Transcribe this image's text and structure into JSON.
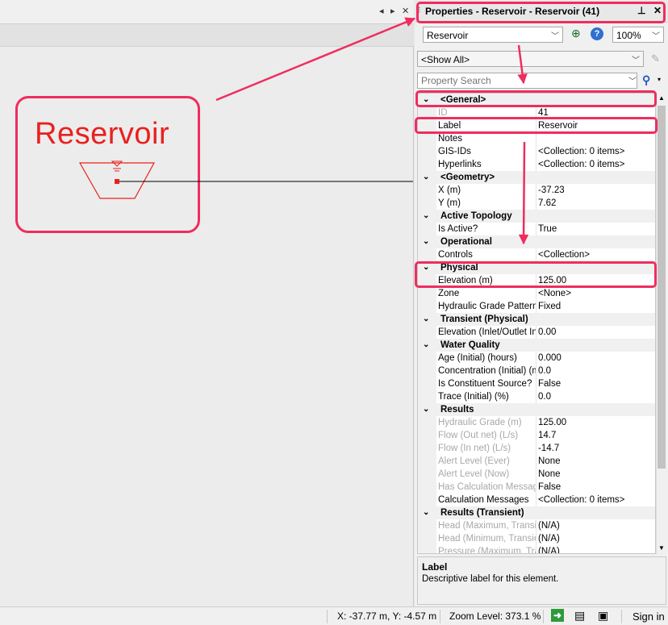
{
  "canvas": {
    "callout_label": "Reservoir",
    "tab_controls": [
      "◂",
      "▸",
      "✕"
    ]
  },
  "panel": {
    "title": "Properties - Reservoir - Reservoir  (41)",
    "pin_icon": "pin-icon",
    "close_icon": "close-icon",
    "element_select": "Reservoir",
    "zoom_select": "100%",
    "filter_select": "<Show All>",
    "search_placeholder": "Property Search"
  },
  "grid": {
    "rows": [
      {
        "type": "cat",
        "label": "<General>"
      },
      {
        "type": "prop",
        "name": "ID",
        "value": "41",
        "readonly": true
      },
      {
        "type": "prop",
        "name": "Label",
        "value": "Reservoir"
      },
      {
        "type": "prop",
        "name": "Notes",
        "value": ""
      },
      {
        "type": "prop",
        "name": "GIS-IDs",
        "value": "<Collection: 0 items>"
      },
      {
        "type": "prop",
        "name": "Hyperlinks",
        "value": "<Collection: 0 items>"
      },
      {
        "type": "cat",
        "label": "<Geometry>"
      },
      {
        "type": "prop",
        "name": "X (m)",
        "value": "-37.23"
      },
      {
        "type": "prop",
        "name": "Y (m)",
        "value": "7.62"
      },
      {
        "type": "cat",
        "label": "Active Topology"
      },
      {
        "type": "prop",
        "name": "Is Active?",
        "value": "True"
      },
      {
        "type": "cat",
        "label": "Operational"
      },
      {
        "type": "prop",
        "name": "Controls",
        "value": "<Collection>"
      },
      {
        "type": "cat",
        "label": "Physical"
      },
      {
        "type": "prop",
        "name": "Elevation (m)",
        "value": "125.00"
      },
      {
        "type": "prop",
        "name": "Zone",
        "value": "<None>"
      },
      {
        "type": "prop",
        "name": "Hydraulic Grade Pattern",
        "value": "Fixed"
      },
      {
        "type": "cat",
        "label": "Transient (Physical)"
      },
      {
        "type": "prop",
        "name": "Elevation (Inlet/Outlet Invert) (m)",
        "value": "0.00"
      },
      {
        "type": "cat",
        "label": "Water Quality"
      },
      {
        "type": "prop",
        "name": "Age (Initial) (hours)",
        "value": "0.000"
      },
      {
        "type": "prop",
        "name": "Concentration (Initial) (mg/L)",
        "value": "0.0"
      },
      {
        "type": "prop",
        "name": "Is Constituent Source?",
        "value": "False"
      },
      {
        "type": "prop",
        "name": "Trace (Initial) (%)",
        "value": "0.0"
      },
      {
        "type": "cat",
        "label": "Results"
      },
      {
        "type": "prop",
        "name": "Hydraulic Grade (m)",
        "value": "125.00",
        "readonly": true
      },
      {
        "type": "prop",
        "name": "Flow (Out net) (L/s)",
        "value": "14.7",
        "readonly": true
      },
      {
        "type": "prop",
        "name": "Flow (In net) (L/s)",
        "value": "-14.7",
        "readonly": true
      },
      {
        "type": "prop",
        "name": "Alert Level (Ever)",
        "value": "None",
        "readonly": true
      },
      {
        "type": "prop",
        "name": "Alert Level (Now)",
        "value": "None",
        "readonly": true
      },
      {
        "type": "prop",
        "name": "Has Calculation Messages?",
        "value": "False",
        "readonly": true
      },
      {
        "type": "prop",
        "name": "Calculation Messages",
        "value": "<Collection: 0 items>"
      },
      {
        "type": "cat",
        "label": "Results (Transient)"
      },
      {
        "type": "prop",
        "name": "Head (Maximum, Transient) (m)",
        "value": "(N/A)",
        "readonly": true
      },
      {
        "type": "prop",
        "name": "Head (Minimum, Transient) (m)",
        "value": "(N/A)",
        "readonly": true
      },
      {
        "type": "prop",
        "name": "Pressure (Maximum, Transient)",
        "value": "(N/A)",
        "readonly": true
      }
    ]
  },
  "description": {
    "title": "Label",
    "text": "Descriptive label for this element."
  },
  "statusbar": {
    "coords": "X: -37.77 m, Y: -4.57 m",
    "zoom": "Zoom Level: 373.1 %",
    "sign_in": "Sign in"
  },
  "colors": {
    "annotation": "#ef2d5e",
    "symbol": "#e8211f"
  }
}
